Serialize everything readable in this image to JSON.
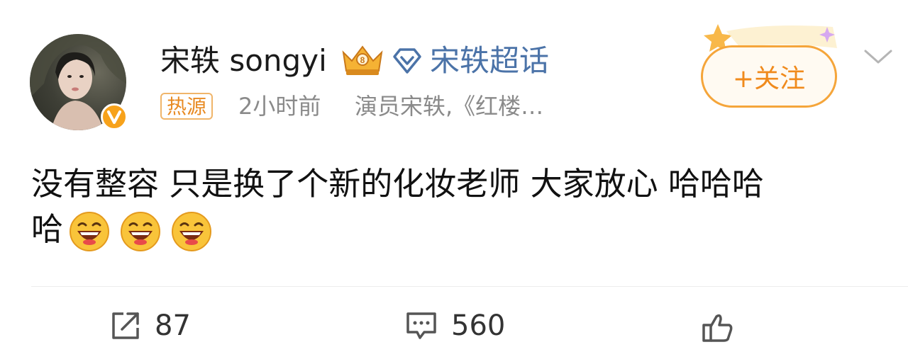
{
  "user": {
    "name": "宋轶 songyi",
    "supertopic_label": "宋轶超话",
    "hot_tag": "热源",
    "time": "2小时前",
    "source": "演员宋轶,《红楼…"
  },
  "follow_button": {
    "label": "+关注"
  },
  "post": {
    "line1": "没有整容 只是换了个新的化妆老师 大家放心 哈哈哈",
    "line2": "哈"
  },
  "actions": {
    "share_count": "87",
    "comment_count": "560"
  },
  "colors": {
    "accent_orange": "#f08a1c",
    "link_blue": "#4b73a8",
    "meta_gray": "#8a8a8a"
  },
  "icons": [
    "vip-crown-icon",
    "supertopic-diamond-icon",
    "verified-v-icon",
    "chevron-down-icon",
    "share-icon",
    "comment-icon",
    "like-icon",
    "laugh-emoji-icon"
  ]
}
